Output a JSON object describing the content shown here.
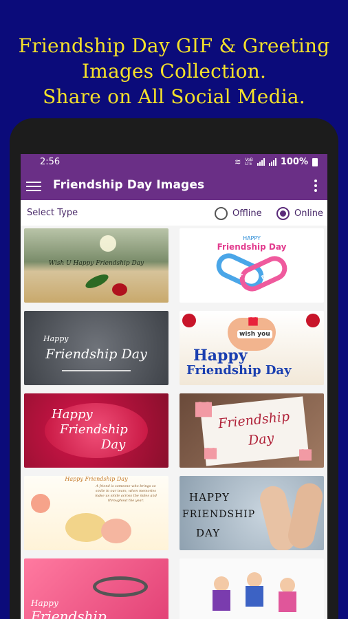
{
  "promo": {
    "line1": "Friendship Day GIF & Greeting",
    "line2": "Images Collection.",
    "line3": "Share on All Social Media."
  },
  "status_bar": {
    "time": "2:56",
    "network_label": "VoB\nLTE",
    "battery": "100%"
  },
  "app_bar": {
    "title": "Friendship Day Images",
    "menu_icon": "hamburger-menu-icon",
    "more_icon": "more-vert-icon"
  },
  "filter": {
    "label": "Select Type",
    "options": [
      {
        "label": "Offline",
        "selected": false
      },
      {
        "label": "Online",
        "selected": true
      }
    ]
  },
  "images": [
    {
      "caption": "Wish U Happy Friendship Day"
    },
    {
      "caption_top": "HAPPY",
      "caption": "Friendship Day",
      "band_text1": "BEST",
      "band_text2": "FRIEND"
    },
    {
      "caption_top": "Happy",
      "caption": "Friendship Day"
    },
    {
      "caption_top": "wish you",
      "caption": "Happy",
      "caption2": "Friendship Day"
    },
    {
      "caption_top": "Happy",
      "caption": "Friendship",
      "caption2": "Day"
    },
    {
      "caption": "Friendship",
      "caption2": "Day"
    },
    {
      "caption_top": "Happy Friendship Day",
      "caption": "A friend is someone who brings so smile in our tears, when memories make us smile across the miles and throughout the year."
    },
    {
      "caption_top": "HAPPY",
      "caption": "FRIENDSHIP",
      "caption2": "DAY"
    },
    {
      "caption_top": "Happy",
      "caption": "Friendship"
    },
    {
      "caption": ""
    }
  ],
  "colors": {
    "background": "#0b0b7a",
    "promo_text": "#f5e12a",
    "app_bar": "#6a2f86",
    "radio_selected": "#5a2a7a"
  }
}
